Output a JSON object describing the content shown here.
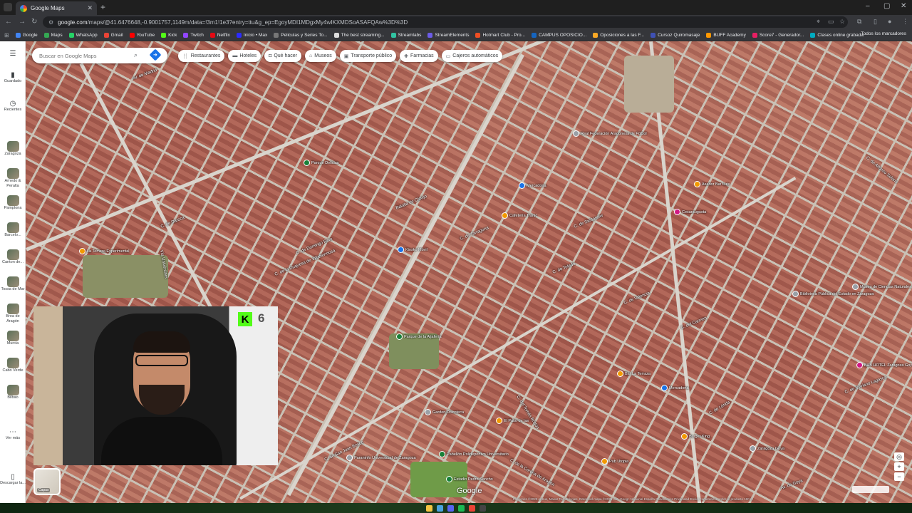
{
  "browser": {
    "tab_title": "Google Maps",
    "url_domain": "google.com",
    "url_path": "/maps/@41.6476648,-0.9001757,1149m/data=!3m1!1e3?entry=ttu&g_ep=EgoyMDI1MDgxMy4wIKXMDSoASAFQAw%3D%3D",
    "bookmarks": [
      {
        "label": "Google",
        "color": "#4285f4"
      },
      {
        "label": "Maps",
        "color": "#34a853"
      },
      {
        "label": "WhatsApp",
        "color": "#25d366"
      },
      {
        "label": "Gmail",
        "color": "#ea4335"
      },
      {
        "label": "YouTube",
        "color": "#ff0000"
      },
      {
        "label": "Kick",
        "color": "#53fc18"
      },
      {
        "label": "Twitch",
        "color": "#9146ff"
      },
      {
        "label": "Netflix",
        "color": "#e50914"
      },
      {
        "label": "Inicio • Max",
        "color": "#2b2bff"
      },
      {
        "label": "Peliculas y Series To...",
        "color": "#777777"
      },
      {
        "label": "The best streaming...",
        "color": "#dddddd"
      },
      {
        "label": "Streamlabs",
        "color": "#31c3a2"
      },
      {
        "label": "StreamElements",
        "color": "#6c5ce7"
      },
      {
        "label": "Hotmart Club - Pro...",
        "color": "#f04e23"
      },
      {
        "label": "CAMPUS OPOSICIO...",
        "color": "#1565c0"
      },
      {
        "label": "Oposiciones a las F...",
        "color": "#f9a825"
      },
      {
        "label": "Cursoz Quiromasaje",
        "color": "#3f51b5"
      },
      {
        "label": "BUFF Academy",
        "color": "#ff9800"
      },
      {
        "label": "Score7 - Generador...",
        "color": "#e91e63"
      },
      {
        "label": "Clases online grabada",
        "color": "#00acc1"
      }
    ],
    "all_bookmarks_label": "Todos los marcadores"
  },
  "sidebar": {
    "menu_icon": "menu-icon",
    "saved_label": "Guardado",
    "recents_label": "Recientes",
    "recent_places": [
      "Zaragoza",
      "Arnedo & Peralta",
      "Pamplona",
      "Barcelo...",
      "Canton de...",
      "Tossa de Mar",
      "Brea de Aragón",
      "Murcia",
      "Cabo Verde",
      "Bilbao"
    ],
    "more_label": "Ver más",
    "download_label": "Descargar la..."
  },
  "search": {
    "placeholder": "Buscar en Google Maps"
  },
  "chips": [
    {
      "label": "Restaurantes",
      "icon": "restaurant-icon"
    },
    {
      "label": "Hoteles",
      "icon": "hotel-icon"
    },
    {
      "label": "Qué hacer",
      "icon": "camera-icon"
    },
    {
      "label": "Museos",
      "icon": "museum-icon"
    },
    {
      "label": "Transporte público",
      "icon": "transit-icon"
    },
    {
      "label": "Farmacias",
      "icon": "pharmacy-icon"
    },
    {
      "label": "Cajeros automáticos",
      "icon": "atm-icon"
    }
  ],
  "streets": [
    "C. de Santander",
    "C. de Tarragona",
    "C. de Toledo",
    "C. de Valencia",
    "Batalla de Clavijo",
    "C. de Domingo Ram",
    "C. de Daroca",
    "C. de la Duquesa de Villahermosa",
    "C. del Tomás Bretón",
    "C. de San Juan Bosco",
    "C. de la Corona de Aragón",
    "C. del Carmen",
    "Av. de Madrid",
    "Vía Univérsitas",
    "C. de Lérida",
    "C. de Mariano Lagasca",
    "Av. de Goya",
    "C. de Alfonso Solans"
  ],
  "pois": [
    {
      "label": "Mercadona",
      "color": "#1a73e8"
    },
    {
      "label": "Cafetería Tranic",
      "color": "#f29900"
    },
    {
      "label": "Kiosko Móvil",
      "color": "#1a73e8"
    },
    {
      "label": "Parque de la Aljafería",
      "color": "#188038"
    },
    {
      "label": "Real Federación Aragonesa de Fútbol",
      "color": "#9aa0a6"
    },
    {
      "label": "Mercadona",
      "color": "#1a73e8"
    },
    {
      "label": "Bar La Terraza",
      "color": "#f29900"
    },
    {
      "label": "Pub Utopia",
      "color": "#f29900"
    },
    {
      "label": "Burger King",
      "color": "#f29900"
    },
    {
      "label": "Zaragoza Goya",
      "color": "#9aa0a6"
    },
    {
      "label": "Biblioteca Pública del Estado en Zaragoza",
      "color": "#9aa0a6"
    },
    {
      "label": "Museo de Ciencias Naturales",
      "color": "#9aa0a6"
    },
    {
      "label": "Parque Delicias",
      "color": "#188038"
    },
    {
      "label": "La Terraza Experimental",
      "color": "#f29900"
    },
    {
      "label": "Paraninfo Universidad de Zaragoza",
      "color": "#9aa0a6"
    },
    {
      "label": "Garden Discoteca",
      "color": "#9aa0a6"
    },
    {
      "label": "Pabellón Polideportivo Universitario",
      "color": "#188038"
    },
    {
      "label": "El Patio de las",
      "color": "#f29900"
    },
    {
      "label": "B&B HOTEL Zaragoza Goya",
      "color": "#d01884"
    },
    {
      "label": "Estadio Pedro Sancho",
      "color": "#188038"
    },
    {
      "label": "Cesaraugusta",
      "color": "#d01884"
    },
    {
      "label": "Asador Bar Luis",
      "color": "#f29900"
    }
  ],
  "webcam": {
    "kick_count": "6"
  },
  "layers_label": "Capas",
  "google_logo": "Google",
  "attribution": "Imágenes ©2025 Airbus, Maxar Technologies, Datos del mapa ©2025 Inst. Geogr. Nacional   España   Condiciones   Privacidad   Enviar comentarios sobre el producto   100 m"
}
